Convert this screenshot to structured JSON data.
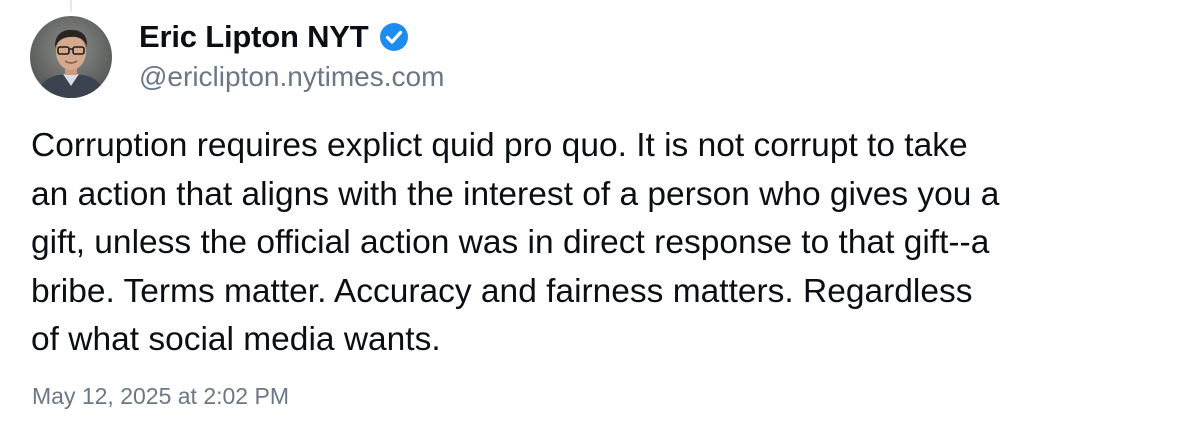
{
  "post": {
    "author": {
      "display_name": "Eric Lipton NYT",
      "handle": "@ericlipton.nytimes.com",
      "verified": true,
      "avatar_icon": "person-photo-avatar"
    },
    "text": "Corruption requires explict quid pro quo. It is not corrupt to take\nan action that aligns with the interest of a person who gives you a\ngift, unless the official action was in direct response to that gift--a\nbribe. Terms matter. Accuracy and fairness matters. Regardless\nof what social media wants.",
    "timestamp": "May 12, 2025 at 2:02 PM"
  },
  "colors": {
    "verified_badge": "#1d8cf0",
    "secondary_text": "#6b7785",
    "primary_text": "#0b0f14"
  }
}
